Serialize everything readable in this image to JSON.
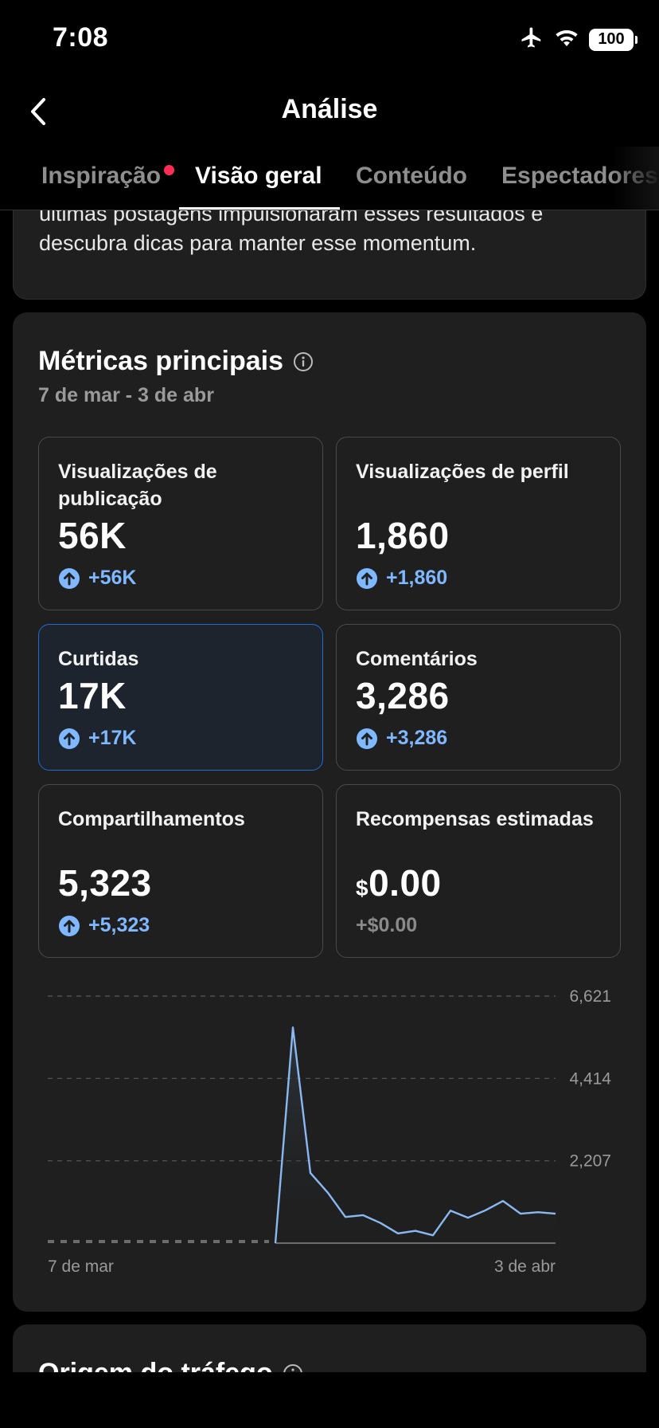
{
  "status_bar": {
    "time": "7:08",
    "battery": "100"
  },
  "nav": {
    "title": "Análise"
  },
  "tabs": [
    {
      "label": "Inspiração",
      "has_dot": true
    },
    {
      "label": "Visão geral",
      "active": true
    },
    {
      "label": "Conteúdo"
    },
    {
      "label": "Espectadores"
    }
  ],
  "intro": {
    "text": "últimas postagens impulsionaram esses resultados e descubra dicas para manter esse momentum."
  },
  "metrics": {
    "title": "Métricas principais",
    "range": "7 de mar - 3 de abr",
    "tiles": [
      {
        "label": "Visualizações de publicação",
        "value": "56K",
        "delta": "+56K"
      },
      {
        "label": "Visualizações de perfil",
        "value": "1,860",
        "delta": "+1,860"
      },
      {
        "label": "Curtidas",
        "value": "17K",
        "delta": "+17K",
        "selected": true
      },
      {
        "label": "Comentários",
        "value": "3,286",
        "delta": "+3,286"
      },
      {
        "label": "Compartilhamentos",
        "value": "5,323",
        "delta": "+5,323"
      },
      {
        "label": "Recompensas estimadas",
        "currency": "$",
        "value": "0.00",
        "delta": "+$0.00"
      }
    ]
  },
  "chart_data": {
    "type": "line",
    "x_labels": [
      "7 de mar",
      "3 de abr"
    ],
    "y_ticks": [
      "6,621",
      "4,414",
      "2,207"
    ],
    "ylim": [
      0,
      6621
    ],
    "grid": true,
    "series": [
      {
        "values": [
          0,
          0,
          0,
          0,
          0,
          0,
          0,
          0,
          0,
          0,
          0,
          0,
          0,
          0,
          5780,
          1880,
          1350,
          700,
          750,
          540,
          260,
          330,
          210,
          870,
          680,
          880,
          1130,
          790,
          830,
          790
        ]
      }
    ],
    "colors": {
      "line": "#8ab8f0"
    }
  },
  "traffic": {
    "title": "Origem do tráfego"
  }
}
